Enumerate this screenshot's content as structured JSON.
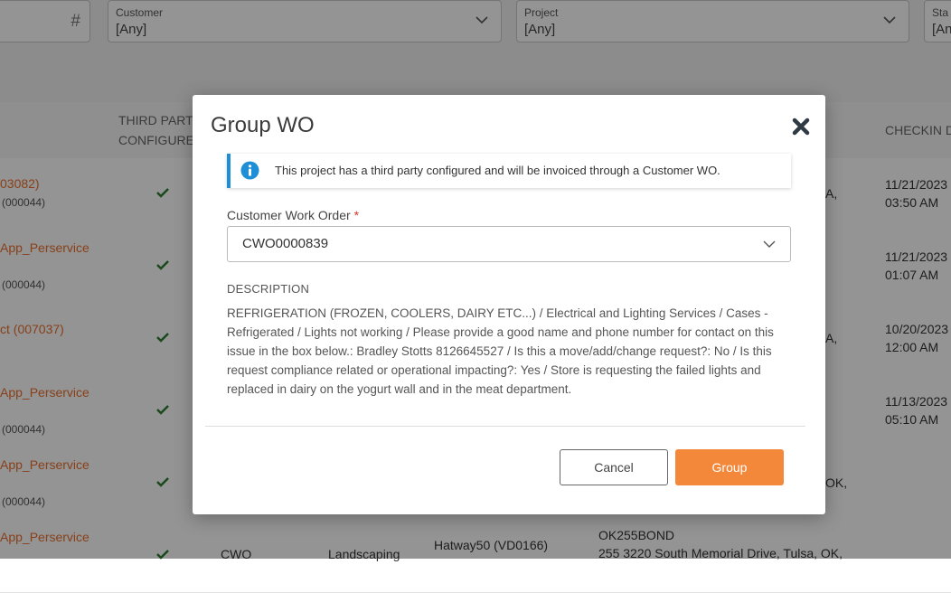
{
  "filters": {
    "hash_symbol": "#",
    "customer": {
      "label": "Customer",
      "value": "[Any]"
    },
    "project": {
      "label": "Project",
      "value": "[Any]"
    },
    "status": {
      "label": "Sta",
      "value": "[An"
    }
  },
  "table": {
    "headers": {
      "third_party_line1": "THIRD PART",
      "third_party_line2": "CONFIGURE",
      "checkin": "CHECKIN D"
    },
    "rows": [
      {
        "link": "03082)",
        "sub": "(000044)",
        "col_a": "A,",
        "date": "11/21/2023",
        "time": "03:50 AM"
      },
      {
        "link": "App_Perservice",
        "sub": "(000044)",
        "col_a": "",
        "date": "11/21/2023",
        "time": "01:07 AM"
      },
      {
        "link": "ct (007037)",
        "sub": "",
        "col_a": "A,",
        "date": "10/20/2023",
        "time": "12:00 AM"
      },
      {
        "link": "App_Perservice",
        "sub": "(000044)",
        "col_a": "",
        "date": "11/13/2023",
        "time": "05:10 AM"
      },
      {
        "link": "App_Perservice",
        "sub": "(000044)",
        "col_a": "OK,",
        "date": "",
        "time": ""
      },
      {
        "link": "App_Perservice",
        "sub": "",
        "col_a": "",
        "date": "",
        "time": "",
        "type": "CWO",
        "service": "Landscaping",
        "vendor": "Hatway50 (VD0166)",
        "store": "OK255BOND",
        "address": "255 3220 South Memorial Drive, Tulsa, OK,"
      }
    ]
  },
  "modal": {
    "title": "Group WO",
    "info": "This project has a third party configured and will be invoiced through a Customer WO.",
    "cwo_label": "Customer Work Order",
    "required_mark": "*",
    "cwo_value": "CWO0000839",
    "description_label": "DESCRIPTION",
    "description": "REFRIGERATION (FROZEN, COOLERS, DAIRY ETC...) / Electrical and Lighting Services / Cases - Refrigerated / Lights not working / Please provide a good name and phone number for contact on this issue in the box below.: Bradley Stotts 8126645527 / Is this a move/add/change request?: No / Is this request compliance related or operational impacting?: Yes / Store is requesting the failed lights and replaced in dairy on the yogurt wall and in the meat department.",
    "cancel_label": "Cancel",
    "group_label": "Group"
  },
  "colors": {
    "accent": "#f3883a",
    "link": "#e86f2e",
    "info": "#1e8fd6",
    "check": "#2e7d32"
  }
}
